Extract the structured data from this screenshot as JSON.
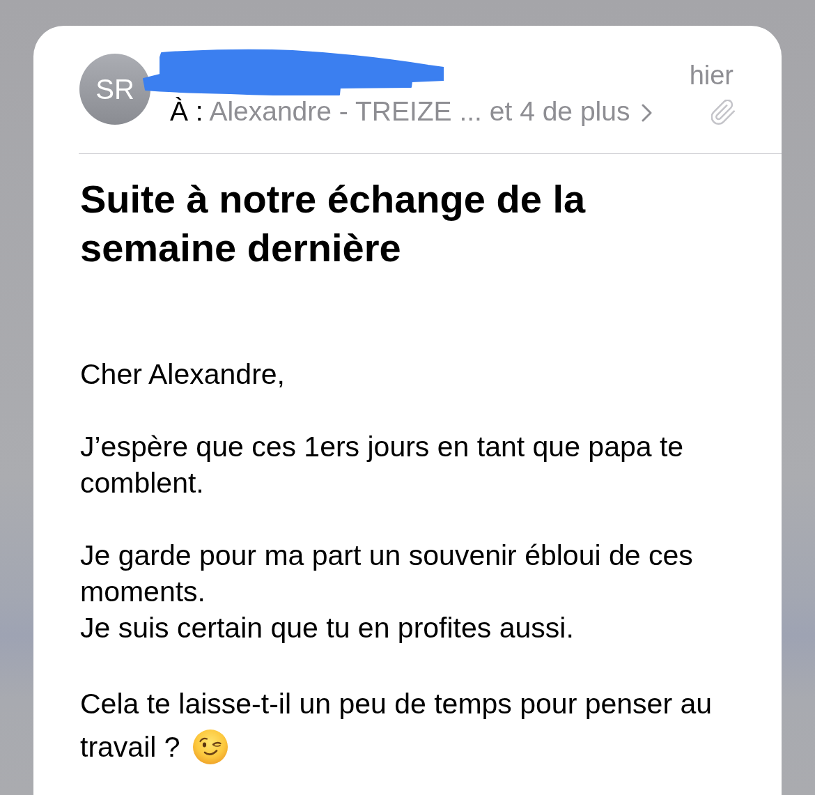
{
  "email": {
    "sender": {
      "initials": "SR",
      "name_redacted": true
    },
    "recipients": {
      "label": "À :",
      "summary": "Alexandre - TREIZE ... et 4 de plus"
    },
    "date": "hier",
    "has_attachment": true,
    "subject": "Suite à notre échange de la semaine dernière",
    "body": [
      {
        "kind": "plain",
        "lines": [
          "Cher Alexandre,"
        ]
      },
      {
        "kind": "plain",
        "lines": [
          "J’espère que ces 1ers jours en tant que papa te comblent."
        ]
      },
      {
        "kind": "plain",
        "lines": [
          "Je garde pour ma part un souvenir ébloui de ces moments.",
          "Je suis certain que tu en profites aussi."
        ]
      },
      {
        "kind": "wink",
        "lines": [
          "Cela te laisse-t-il un peu de temps pour penser au",
          "travail ?"
        ]
      }
    ]
  }
}
